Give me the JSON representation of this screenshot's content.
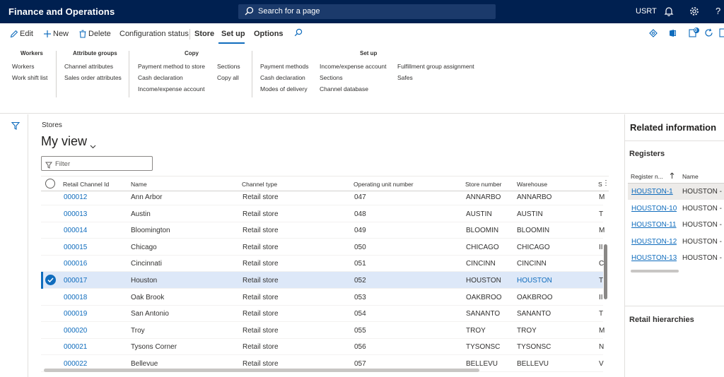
{
  "app": {
    "title": "Finance and Operations",
    "search_placeholder": "Search for a page",
    "company": "USRT"
  },
  "actionbar": {
    "edit": "Edit",
    "new": "New",
    "delete": "Delete",
    "config_status": "Configuration status",
    "store_tab": "Store",
    "setup_tab": "Set up",
    "options_tab": "Options",
    "notification_count": "0"
  },
  "ribbon": {
    "groups": [
      {
        "header": "Workers",
        "items": [
          "Workers",
          "Work shift list"
        ]
      },
      {
        "header": "Attribute groups",
        "items": [
          "Channel attributes",
          "Sales order attributes"
        ]
      },
      {
        "header": "Copy",
        "items": [
          "Payment method to store",
          "Cash declaration",
          "Income/expense account",
          "Sections",
          "Copy all"
        ]
      },
      {
        "header": "Set up",
        "items": [
          "Payment methods",
          "Cash declaration",
          "Modes of delivery",
          "Income/expense account",
          "Sections",
          "Channel database",
          "Fulfillment group assignment",
          "Safes"
        ]
      }
    ]
  },
  "page": {
    "breadcrumb": "Stores",
    "view_title": "My view",
    "filter_placeholder": "Filter"
  },
  "grid": {
    "columns": [
      "Retail Channel Id",
      "Name",
      "Channel type",
      "Operating unit number",
      "Store number",
      "Warehouse",
      "S"
    ],
    "rows": [
      {
        "id": "000012",
        "name": "Ann Arbor",
        "type": "Retail store",
        "ou": "047",
        "store": "ANNARBO",
        "wh": "ANNARBO",
        "s": "M"
      },
      {
        "id": "000013",
        "name": "Austin",
        "type": "Retail store",
        "ou": "048",
        "store": "AUSTIN",
        "wh": "AUSTIN",
        "s": "T"
      },
      {
        "id": "000014",
        "name": "Bloomington",
        "type": "Retail store",
        "ou": "049",
        "store": "BLOOMIN",
        "wh": "BLOOMIN",
        "s": "M"
      },
      {
        "id": "000015",
        "name": "Chicago",
        "type": "Retail store",
        "ou": "050",
        "store": "CHICAGO",
        "wh": "CHICAGO",
        "s": "II"
      },
      {
        "id": "000016",
        "name": "Cincinnati",
        "type": "Retail store",
        "ou": "051",
        "store": "CINCINN",
        "wh": "CINCINN",
        "s": "C"
      },
      {
        "id": "000017",
        "name": "Houston",
        "type": "Retail store",
        "ou": "052",
        "store": "HOUSTON",
        "wh": "HOUSTON",
        "s": "T"
      },
      {
        "id": "000018",
        "name": "Oak Brook",
        "type": "Retail store",
        "ou": "053",
        "store": "OAKBROO",
        "wh": "OAKBROO",
        "s": "II"
      },
      {
        "id": "000019",
        "name": "San Antonio",
        "type": "Retail store",
        "ou": "054",
        "store": "SANANTO",
        "wh": "SANANTO",
        "s": "T"
      },
      {
        "id": "000020",
        "name": "Troy",
        "type": "Retail store",
        "ou": "055",
        "store": "TROY",
        "wh": "TROY",
        "s": "M"
      },
      {
        "id": "000021",
        "name": "Tysons Corner",
        "type": "Retail store",
        "ou": "056",
        "store": "TYSONSC",
        "wh": "TYSONSC",
        "s": "N"
      },
      {
        "id": "000022",
        "name": "Bellevue",
        "type": "Retail store",
        "ou": "057",
        "store": "BELLEVU",
        "wh": "BELLEVU",
        "s": "V"
      }
    ],
    "selected_index": 5
  },
  "related": {
    "title": "Related information",
    "registers_title": "Registers",
    "register_columns": [
      "Register n...",
      "Name"
    ],
    "registers": [
      {
        "id": "HOUSTON-1",
        "name": "HOUSTON - R"
      },
      {
        "id": "HOUSTON-10",
        "name": "HOUSTON - R"
      },
      {
        "id": "HOUSTON-11",
        "name": "HOUSTON - R"
      },
      {
        "id": "HOUSTON-12",
        "name": "HOUSTON - R"
      },
      {
        "id": "HOUSTON-13",
        "name": "HOUSTON - R"
      }
    ],
    "hierarchies_title": "Retail hierarchies"
  },
  "colors": {
    "nav": "#002050",
    "accent": "#0f6cbd",
    "selected_row": "#dde8f8"
  }
}
